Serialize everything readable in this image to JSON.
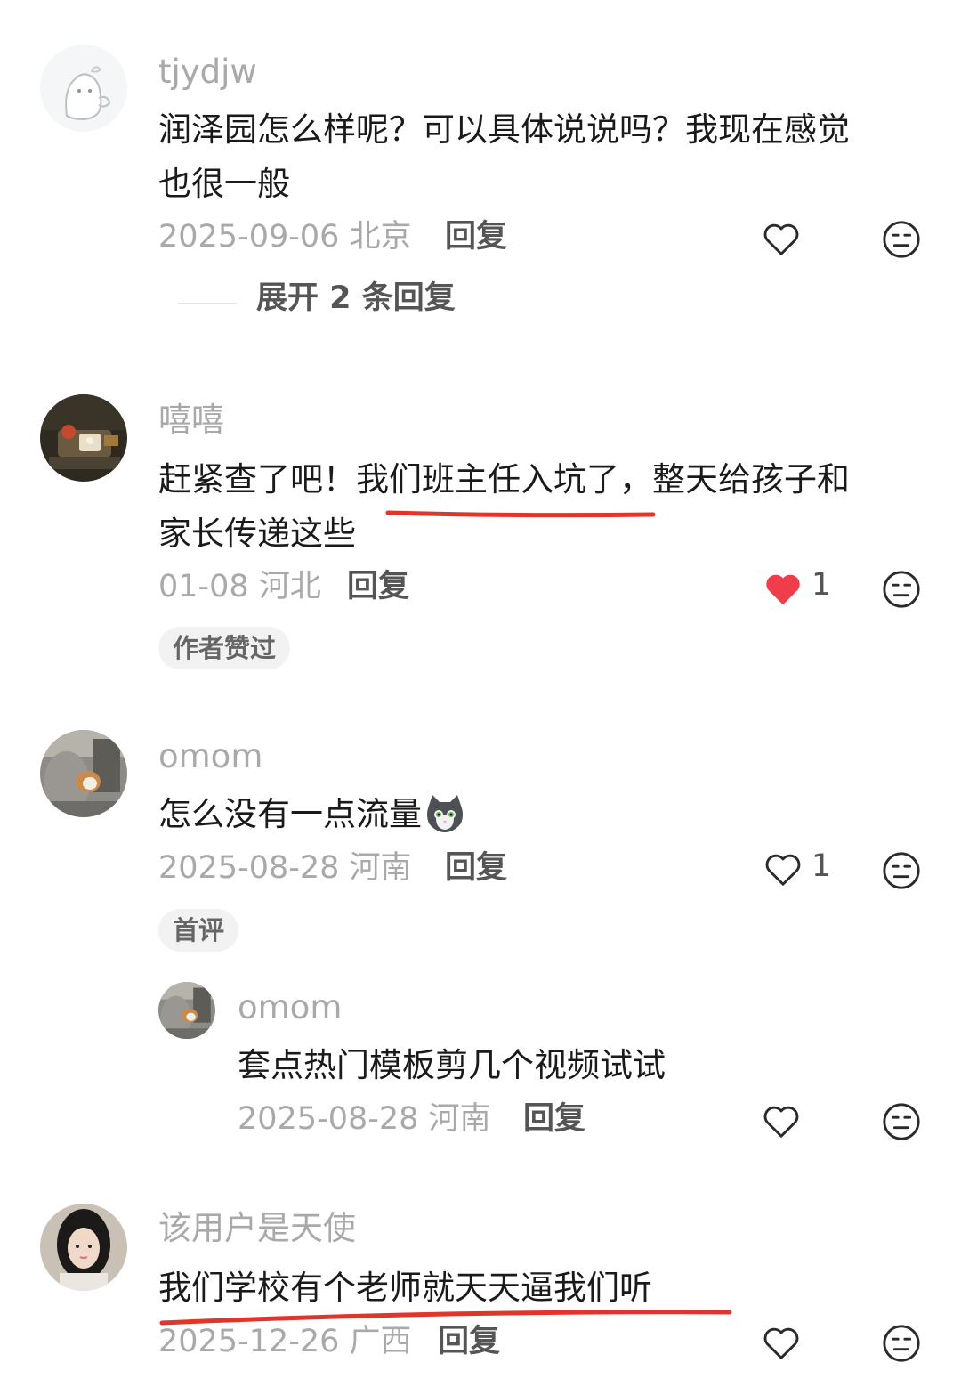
{
  "comments": [
    {
      "username": "tjydjw",
      "text_line1": "润泽园怎么样呢？可以具体说说吗？我现在感觉",
      "text_line2": "也很一般",
      "date": "2025-09-06",
      "location": "北京",
      "reply_label": "回复",
      "expand_label": "展开 2 条回复"
    },
    {
      "username": "嘻嘻",
      "text_line1": "赶紧查了吧！我们班主任入坑了，整天给孩子和",
      "text_line2": "家长传递这些",
      "date": "01-08",
      "location": "河北",
      "reply_label": "回复",
      "like_count": "1",
      "liked": true,
      "tag": "作者赞过"
    },
    {
      "username": "omom",
      "text_line1": "怎么没有一点流量",
      "emoji": "cat-sticker-emoji",
      "date": "2025-08-28",
      "location": "河南",
      "reply_label": "回复",
      "like_count": "1",
      "tag": "首评",
      "reply": {
        "username": "omom",
        "text": "套点热门模板剪几个视频试试",
        "date": "2025-08-28",
        "location": "河南",
        "reply_label": "回复"
      }
    },
    {
      "username": "该用户是天使",
      "text_line1": "我们学校有个老师就天天逼我们听",
      "date": "2025-12-26",
      "location": "广西",
      "reply_label": "回复"
    }
  ],
  "colors": {
    "like_active": "#f03d4a",
    "annotation_underline": "#e0352b",
    "muted_text": "#a9a9ab"
  },
  "icons": [
    "heart-outline-icon",
    "heart-filled-icon",
    "dislike-face-icon"
  ]
}
